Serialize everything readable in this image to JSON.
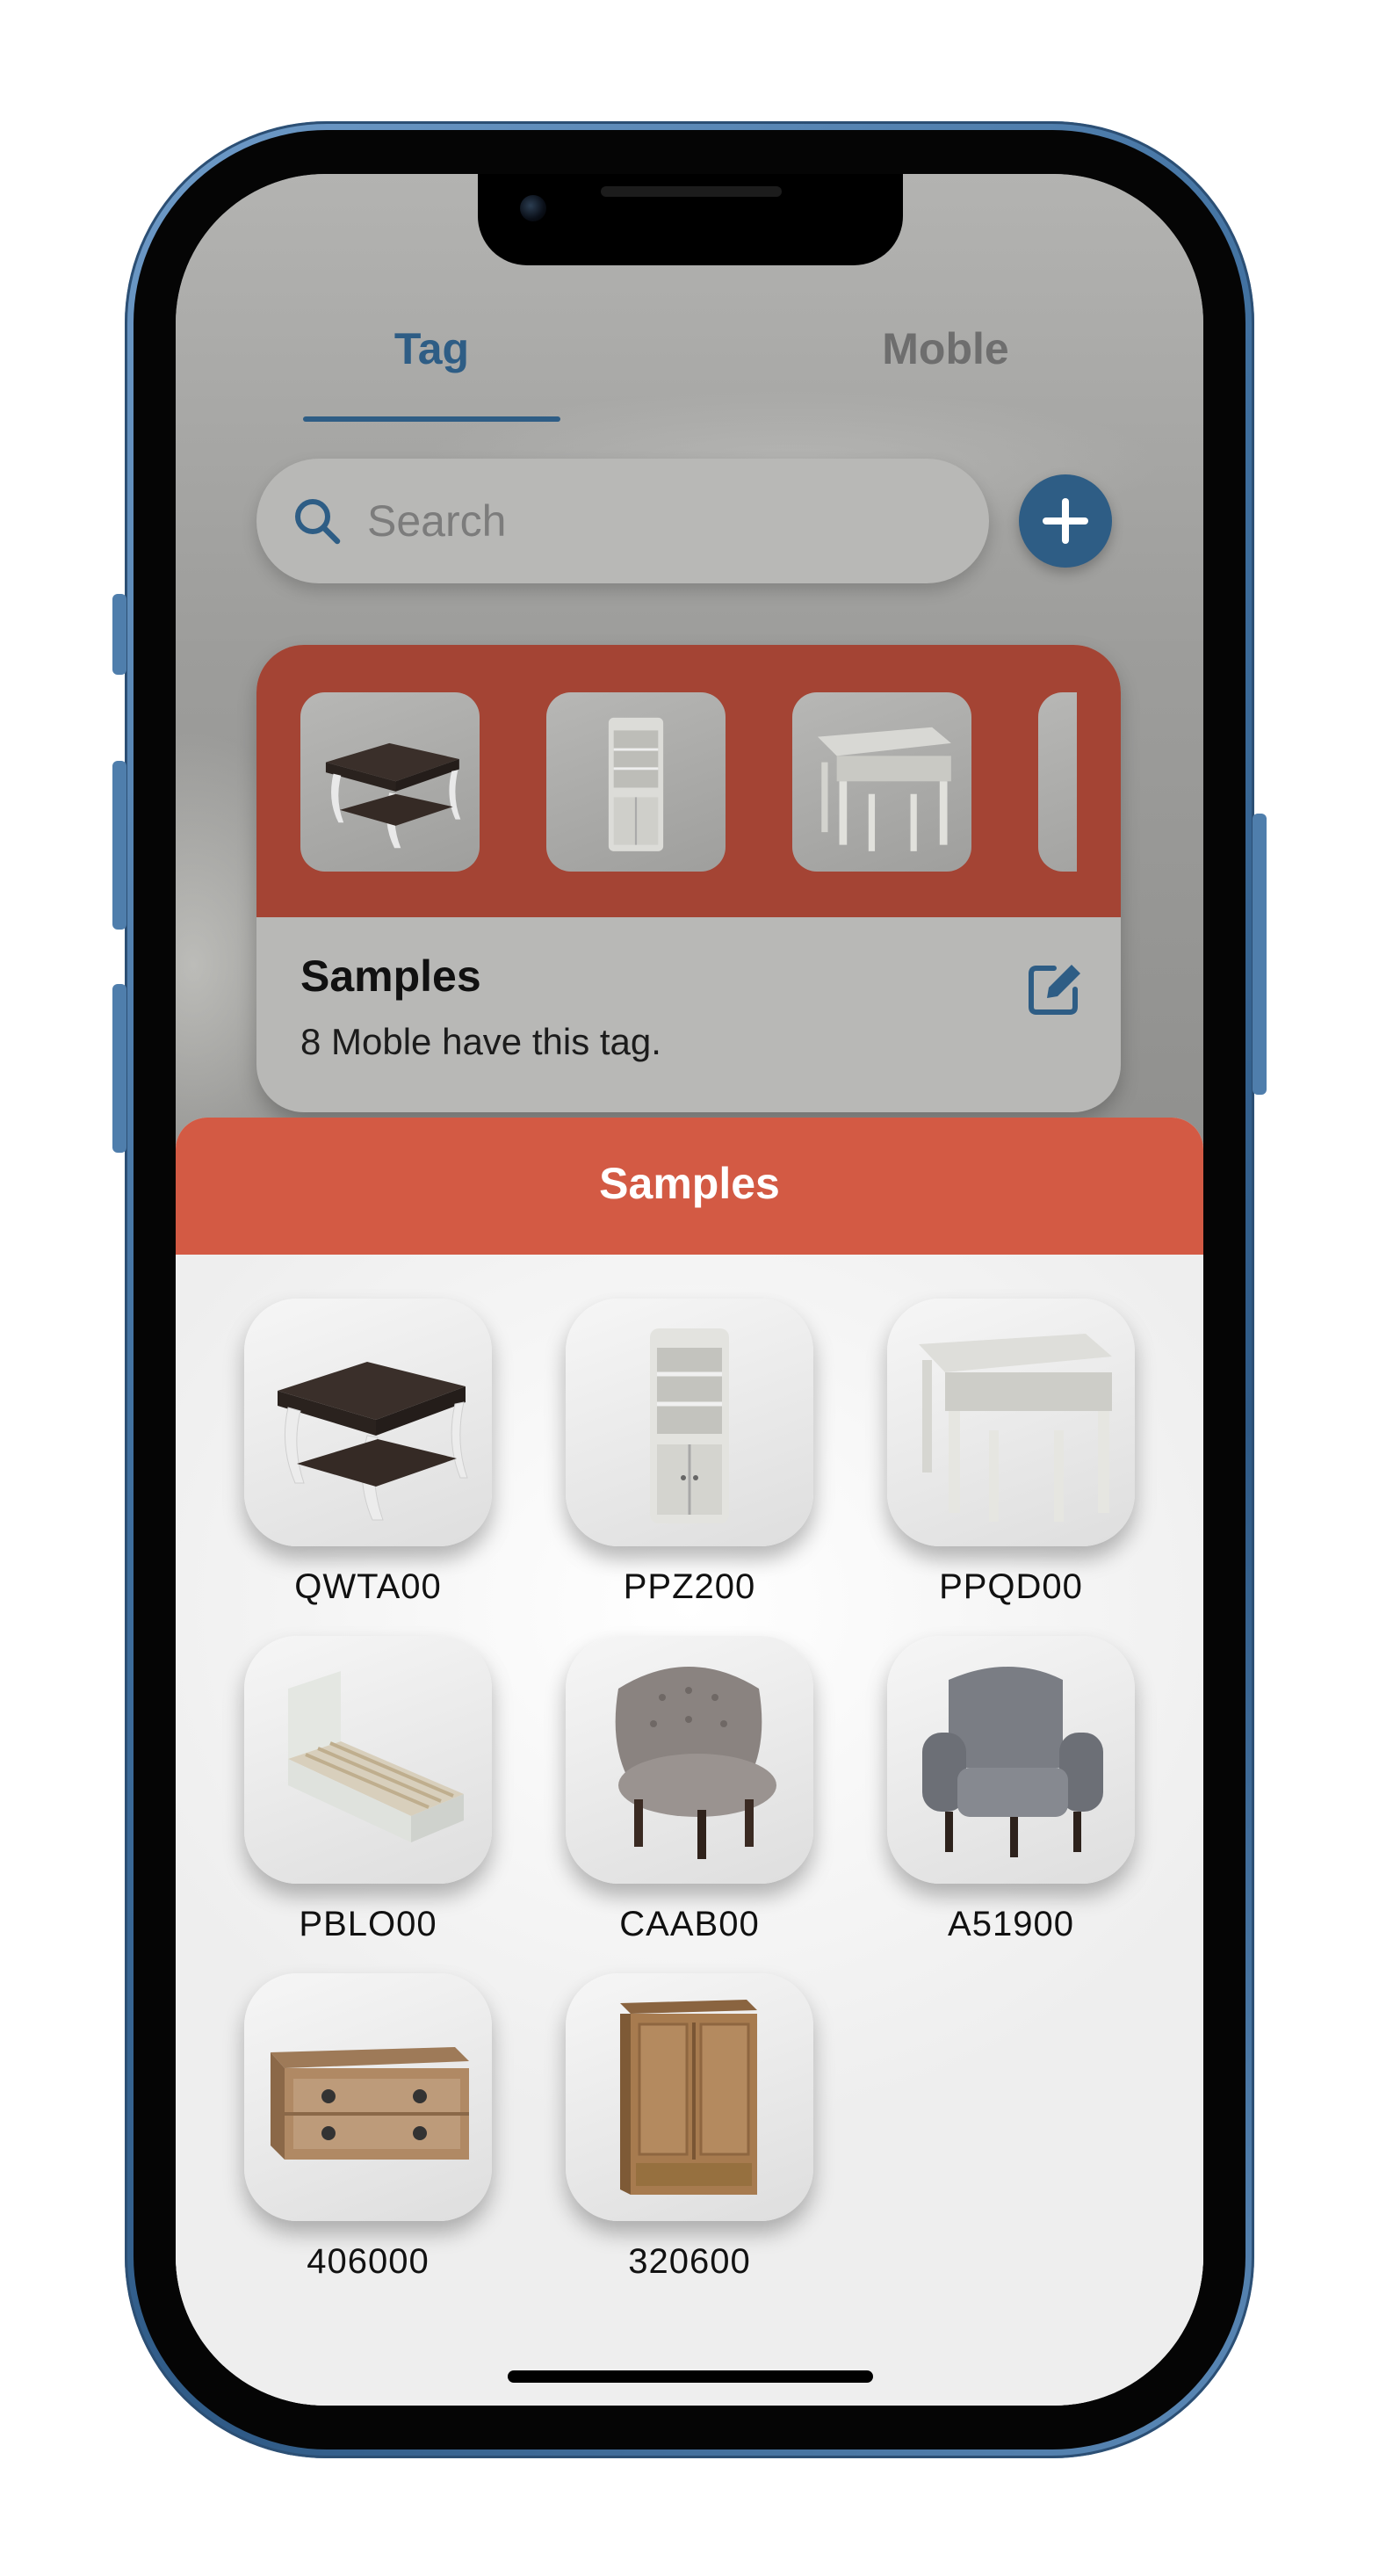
{
  "tabs": [
    {
      "label": "Tag",
      "active": true
    },
    {
      "label": "Moble",
      "active": false
    }
  ],
  "search": {
    "placeholder": "Search"
  },
  "tag_card": {
    "title": "Samples",
    "subtitle": "8 Moble have this tag.",
    "header_color": "#a44434",
    "thumbnails": [
      "side-table",
      "corner-cabinet",
      "nesting-tables",
      "partial-item"
    ]
  },
  "sheet": {
    "title": "Samples",
    "header_color": "#d35a44",
    "items": [
      {
        "label": "QWTA00",
        "icon": "side-table"
      },
      {
        "label": "PPZ200",
        "icon": "corner-cabinet"
      },
      {
        "label": "PPQD00",
        "icon": "nesting-tables"
      },
      {
        "label": "PBLO00",
        "icon": "single-bed"
      },
      {
        "label": "CAAB00",
        "icon": "tufted-chair"
      },
      {
        "label": "A51900",
        "icon": "armchair"
      },
      {
        "label": "406000",
        "icon": "tv-stand"
      },
      {
        "label": "320600",
        "icon": "wardrobe"
      }
    ]
  },
  "colors": {
    "accent": "#2e5d85",
    "frame": "#3f6f9e"
  }
}
